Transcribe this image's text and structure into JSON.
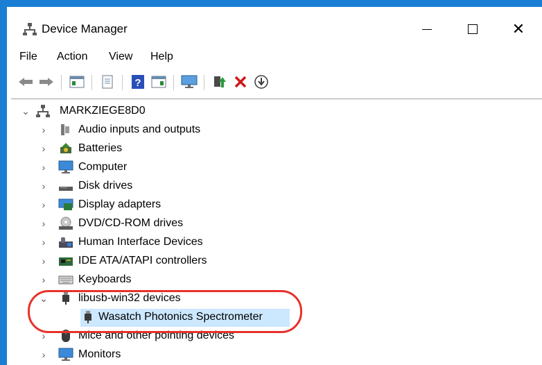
{
  "window": {
    "title": "Device Manager",
    "frame_color": "#1a7fd4"
  },
  "menu": [
    "File",
    "Action",
    "View",
    "Help"
  ],
  "toolbar": {
    "icons": [
      "back-arrow-icon",
      "forward-arrow-icon",
      "properties-panel-icon",
      "show-hidden-icon",
      "help-icon",
      "action-pane-icon",
      "monitor-icon",
      "update-driver-icon",
      "uninstall-x-icon",
      "scan-download-icon"
    ]
  },
  "tree": {
    "root": "MARKZIEGE8D0",
    "categories": [
      {
        "label": "Audio inputs and outputs",
        "icon": "speaker-icon",
        "expanded": false
      },
      {
        "label": "Batteries",
        "icon": "battery-icon",
        "expanded": false
      },
      {
        "label": "Computer",
        "icon": "computer-monitor-icon",
        "expanded": false
      },
      {
        "label": "Disk drives",
        "icon": "disk-drive-icon",
        "expanded": false
      },
      {
        "label": "Display adapters",
        "icon": "display-adapter-icon",
        "expanded": false
      },
      {
        "label": "DVD/CD-ROM drives",
        "icon": "dvd-drive-icon",
        "expanded": false
      },
      {
        "label": "Human Interface Devices",
        "icon": "hid-icon",
        "expanded": false
      },
      {
        "label": "IDE ATA/ATAPI controllers",
        "icon": "ide-controller-icon",
        "expanded": false
      },
      {
        "label": "Keyboards",
        "icon": "keyboard-icon",
        "expanded": false
      },
      {
        "label": "libusb-win32 devices",
        "icon": "usb-plug-icon",
        "expanded": true,
        "children": [
          {
            "label": "Wasatch Photonics Spectrometer",
            "icon": "usb-plug-icon",
            "selected": true
          }
        ]
      },
      {
        "label": "Mice and other pointing devices",
        "icon": "mouse-icon",
        "expanded": false
      },
      {
        "label": "Monitors",
        "icon": "monitor-icon",
        "expanded": false
      }
    ]
  },
  "annotation": {
    "color": "#e8312a"
  }
}
